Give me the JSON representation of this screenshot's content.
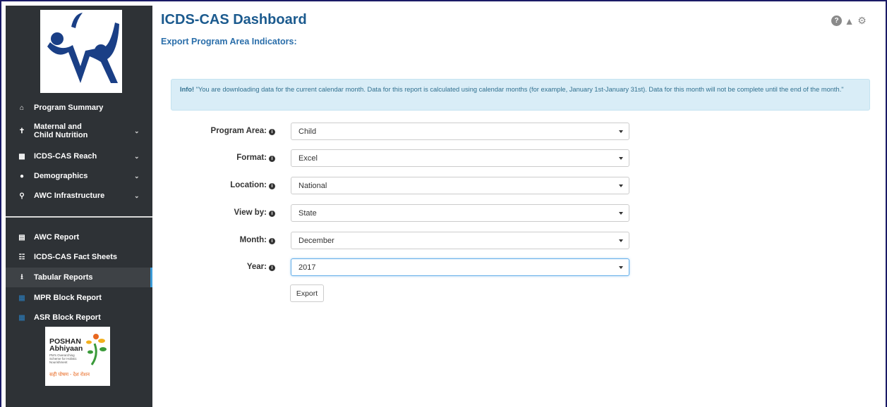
{
  "app": {
    "title": "ICDS-CAS Dashboard",
    "subtitle": "Export Program Area Indicators:"
  },
  "top_icons": [
    "help-icon",
    "warning-icon",
    "settings-icon"
  ],
  "sidebar": {
    "menu_top": [
      {
        "label": "Program Summary",
        "icon": "home-icon",
        "expandable": false
      },
      {
        "label": "Maternal and Child Nutrition",
        "icon": "child-icon",
        "expandable": true
      },
      {
        "label": "ICDS-CAS Reach",
        "icon": "bar-chart-icon",
        "expandable": true
      },
      {
        "label": "Demographics",
        "icon": "users-icon",
        "expandable": true
      },
      {
        "label": "AWC Infrastructure",
        "icon": "lightbulb-icon",
        "expandable": true
      }
    ],
    "menu_bottom": [
      {
        "label": "AWC Report",
        "icon": "table-icon"
      },
      {
        "label": "ICDS-CAS Fact Sheets",
        "icon": "file-icon"
      },
      {
        "label": "Tabular Reports",
        "icon": "download-icon",
        "active": true
      },
      {
        "label": "MPR Block Report",
        "icon": "report-icon"
      },
      {
        "label": "ASR Block Report",
        "icon": "report-icon"
      }
    ],
    "poshan": {
      "line1": "POSHAN",
      "line2": "Abhiyaan",
      "line3": "PM's Overarching Scheme for Holistic Nourishment",
      "line4": "सही पोषण - देश रोशन"
    }
  },
  "info": {
    "prefix": "Info!",
    "text": " \"You are downloading data for the current calendar month. Data for this report is calculated using calendar months (for example, January 1st-January 31st). Data for this month will not be complete until the end of the month.\""
  },
  "form": {
    "fields": [
      {
        "label": "Program Area:",
        "value": "Child"
      },
      {
        "label": "Format:",
        "value": "Excel"
      },
      {
        "label": "Location:",
        "value": "National"
      },
      {
        "label": "View by:",
        "value": "State"
      },
      {
        "label": "Month:",
        "value": "December"
      },
      {
        "label": "Year:",
        "value": "2017"
      }
    ],
    "export_label": "Export"
  },
  "colors": {
    "sidebar_bg": "#2e3236",
    "title": "#1b5a8e",
    "info_bg": "#d9edf7",
    "active_bar": "#3c9bd6"
  }
}
